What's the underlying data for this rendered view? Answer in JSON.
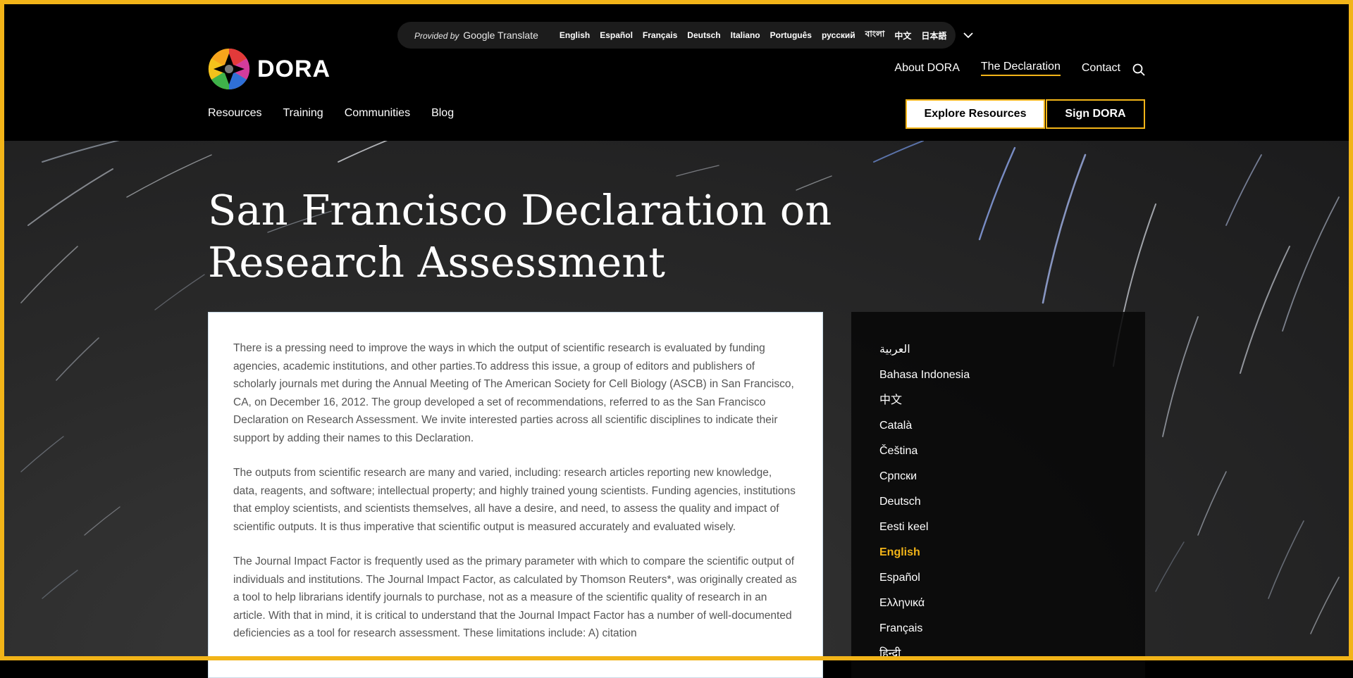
{
  "translate_bar": {
    "provided_by": "Provided by",
    "service": "Google Translate",
    "languages": [
      "English",
      "Español",
      "Français",
      "Deutsch",
      "Italiano",
      "Português",
      "русский",
      "বাংলা",
      "中文",
      "日本語"
    ]
  },
  "logo": {
    "text": "DORA"
  },
  "top_nav": {
    "items": [
      "About DORA",
      "The Declaration",
      "Contact"
    ],
    "active": "The Declaration"
  },
  "main_nav": {
    "items": [
      "Resources",
      "Training",
      "Communities",
      "Blog"
    ]
  },
  "buttons": {
    "explore": "Explore Resources",
    "sign": "Sign DORA"
  },
  "page": {
    "title": "San Francisco Declaration on Research Assessment"
  },
  "content": {
    "paragraphs": [
      "There is a pressing need to improve the ways in which the output of scientific research is evaluated by funding agencies, academic institutions, and other parties.To address this issue, a group of editors and publishers of scholarly journals met during the Annual Meeting of The American Society for Cell Biology (ASCB) in San Francisco, CA, on December 16, 2012. The group developed a set of recommendations, referred to as the San Francisco Declaration on Research Assessment. We invite interested parties across all scientific disciplines to indicate their support by adding their names to this Declaration.",
      "The outputs from scientific research are many and varied, including: research articles reporting new knowledge, data, reagents, and software; intellectual property; and highly trained young scientists. Funding agencies, institutions that employ scientists, and scientists themselves, all have a desire, and need, to assess the quality and impact of scientific outputs. It is thus imperative that scientific output is measured accurately and evaluated wisely.",
      "The Journal Impact Factor is frequently used as the primary parameter with which to compare the scientific output of individuals and institutions. The Journal Impact Factor, as calculated by Thomson Reuters*, was originally created as a tool to help librarians identify journals to purchase, not as a measure of the scientific quality of research in an article. With that in mind, it is critical to understand that the Journal Impact Factor has a number of well-documented deficiencies as a tool for research assessment. These limitations include: A) citation"
    ]
  },
  "language_list": {
    "items": [
      "العربية",
      "Bahasa Indonesia",
      "中文",
      "Català",
      "Čeština",
      "Српски",
      "Deutsch",
      "Eesti keel",
      "English",
      "Español",
      "Ελληνικά",
      "Français",
      "हिन्दी"
    ],
    "current": "English"
  },
  "colors": {
    "accent": "#f2b418",
    "header_bg": "#000000",
    "card_bg": "#ffffff"
  }
}
